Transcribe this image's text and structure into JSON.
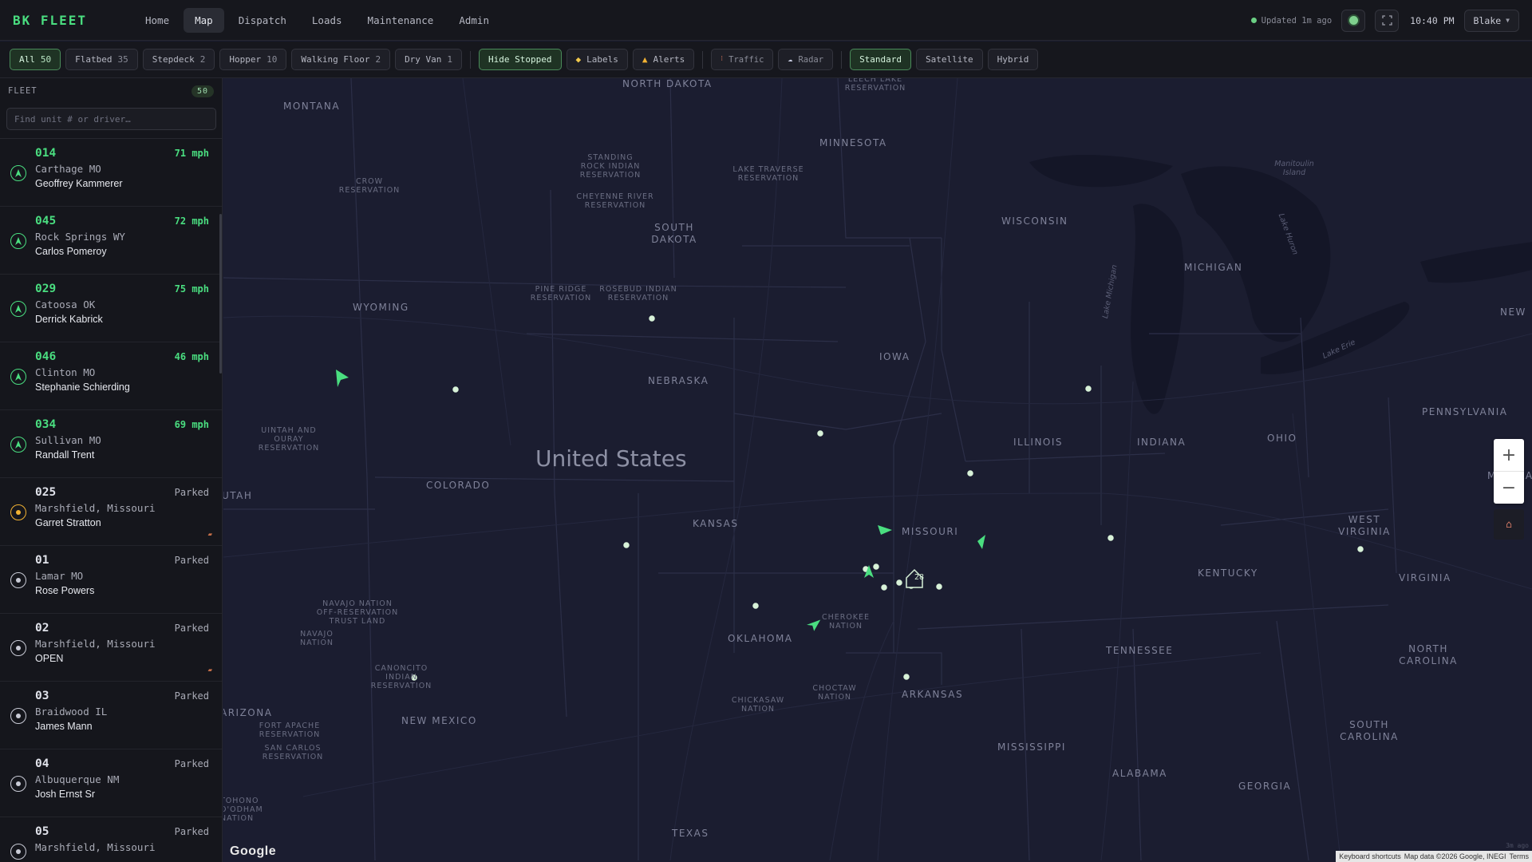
{
  "app": {
    "brand": "BK FLEET"
  },
  "nav": {
    "items": [
      {
        "label": "Home",
        "active": false
      },
      {
        "label": "Map",
        "active": true
      },
      {
        "label": "Dispatch",
        "active": false
      },
      {
        "label": "Loads",
        "active": false
      },
      {
        "label": "Maintenance",
        "active": false
      },
      {
        "label": "Admin",
        "active": false
      }
    ]
  },
  "status": {
    "updated": "Updated 1m ago",
    "time": "10:40 PM",
    "user": "Blake"
  },
  "filters": {
    "types": [
      {
        "label": "All",
        "count": "50",
        "active": true
      },
      {
        "label": "Flatbed",
        "count": "35",
        "active": false
      },
      {
        "label": "Stepdeck",
        "count": "2",
        "active": false
      },
      {
        "label": "Hopper",
        "count": "10",
        "active": false
      },
      {
        "label": "Walking Floor",
        "count": "2",
        "active": false
      },
      {
        "label": "Dry Van",
        "count": "1",
        "active": false
      }
    ],
    "toggles": {
      "hide_stopped": "Hide Stopped",
      "labels": "Labels",
      "alerts": "Alerts",
      "traffic": "Traffic",
      "radar": "Radar"
    },
    "map_types": [
      {
        "label": "Standard",
        "active": true
      },
      {
        "label": "Satellite",
        "active": false
      },
      {
        "label": "Hybrid",
        "active": false
      }
    ]
  },
  "sidebar": {
    "title": "FLEET",
    "count": "50",
    "search_placeholder": "Find unit # or driver…",
    "units": [
      {
        "id": "014",
        "status": "71 mph",
        "moving": true,
        "location": "Carthage MO",
        "driver": "Geoffrey Kammerer"
      },
      {
        "id": "045",
        "status": "72 mph",
        "moving": true,
        "location": "Rock Springs WY",
        "driver": "Carlos Pomeroy"
      },
      {
        "id": "029",
        "status": "75 mph",
        "moving": true,
        "location": "Catoosa OK",
        "driver": "Derrick Kabrick"
      },
      {
        "id": "046",
        "status": "46 mph",
        "moving": true,
        "location": "Clinton MO",
        "driver": "Stephanie Schierding"
      },
      {
        "id": "034",
        "status": "69 mph",
        "moving": true,
        "location": "Sullivan MO",
        "driver": "Randall Trent"
      },
      {
        "id": "025",
        "status": "Parked",
        "moving": false,
        "highlight": true,
        "location": "Marshfield, Missouri",
        "driver": "Garret Stratton",
        "flag": true
      },
      {
        "id": "01",
        "status": "Parked",
        "moving": false,
        "location": "Lamar MO",
        "driver": "Rose Powers"
      },
      {
        "id": "02",
        "status": "Parked",
        "moving": false,
        "location": "Marshfield, Missouri",
        "driver": "OPEN",
        "flag": true
      },
      {
        "id": "03",
        "status": "Parked",
        "moving": false,
        "location": "Braidwood IL",
        "driver": "James Mann"
      },
      {
        "id": "04",
        "status": "Parked",
        "moving": false,
        "location": "Albuquerque NM",
        "driver": "Josh Ernst Sr"
      },
      {
        "id": "05",
        "status": "Parked",
        "moving": false,
        "location": "Marshfield, Missouri",
        "driver": ""
      }
    ]
  },
  "map": {
    "country_label": "United States",
    "cluster_count": "28",
    "zoom_in": "+",
    "zoom_out": "−",
    "logo": "Google",
    "attribution": [
      "Keyboard shortcuts",
      "Map data ©2026 Google, INEGI",
      "Terms"
    ],
    "stamp": "3m ago",
    "state_labels": [
      "MONTANA",
      "NORTH DAKOTA",
      "MINNESOTA",
      "WISCONSIN",
      "MICHIGAN",
      "SOUTH DAKOTA",
      "WYOMING",
      "IOWA",
      "NEBRASKA",
      "ILLINOIS",
      "INDIANA",
      "OHIO",
      "PENNSYLVANIA",
      "NEW",
      "UTAH",
      "COLORADO",
      "KANSAS",
      "MISSOURI",
      "WEST VIRGINIA",
      "VIRGINIA",
      "KENTUCKY",
      "OKLAHOMA",
      "TENNESSEE",
      "NORTH CAROLINA",
      "ARIZONA",
      "NEW MEXICO",
      "ARKANSAS",
      "MISSISSIPPI",
      "ALABAMA",
      "GEORGIA",
      "SOUTH CAROLINA",
      "TEXAS",
      "MARYLAND"
    ],
    "reservation_labels": [
      "LEECH LAKE RESERVATION",
      "STANDING ROCK INDIAN RESERVATION",
      "LAKE TRAVERSE RESERVATION",
      "CROW RESERVATION",
      "CHEYENNE RIVER RESERVATION",
      "PINE RIDGE RESERVATION",
      "ROSEBUD INDIAN RESERVATION",
      "UINTAH AND OURAY RESERVATION",
      "NAVAJO NATION OFF-RESERVATION TRUST LAND",
      "NAVAJO NATION",
      "CHEROKEE NATION",
      "CANONCITO INDIAN RESERVATION",
      "CHICKASAW NATION",
      "CHOCTAW NATION",
      "FORT APACHE RESERVATION",
      "SAN CARLOS RESERVATION",
      "TOHONO O'ODHAM NATION"
    ],
    "water_labels": [
      "Lake Michigan",
      "Lake Huron",
      "Lake Erie",
      "Manitoulin Island"
    ]
  }
}
